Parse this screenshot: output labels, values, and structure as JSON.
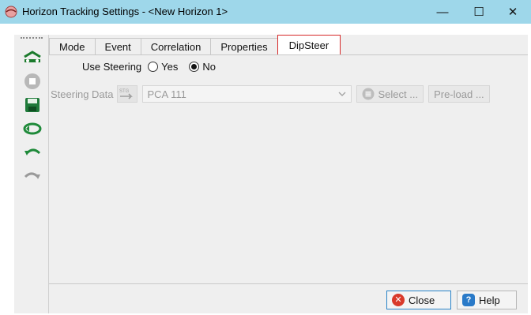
{
  "window": {
    "title": "Horizon Tracking Settings - <New Horizon 1>",
    "minimize_glyph": "—",
    "maximize_glyph": "☐",
    "close_glyph": "✕"
  },
  "toolbar": {
    "icons": [
      "horizon-icon",
      "stop-icon",
      "save-icon",
      "retrack-icon",
      "undo-icon",
      "redo-icon"
    ]
  },
  "tabs": [
    {
      "label": "Mode",
      "active": false
    },
    {
      "label": "Event",
      "active": false
    },
    {
      "label": "Correlation",
      "active": false
    },
    {
      "label": "Properties",
      "active": false
    },
    {
      "label": "DipSteer",
      "active": true
    }
  ],
  "dipsteer": {
    "use_steering_label": "Use Steering",
    "yes_label": "Yes",
    "no_label": "No",
    "selected": "No",
    "steering_data_label": "Steering Data",
    "steering_data_value": "PCA 111",
    "select_label": "Select ...",
    "preload_label": "Pre-load ..."
  },
  "footer": {
    "close_label": "Close",
    "help_label": "Help"
  },
  "colors": {
    "titlebar": "#9ed7ea",
    "active_tab_border": "#d62828",
    "close_button_border": "#2a84c8"
  }
}
